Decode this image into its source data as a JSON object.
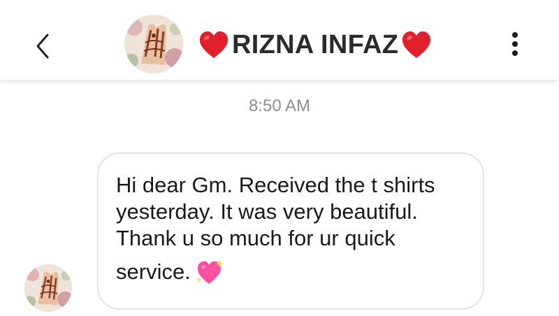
{
  "header": {
    "back_icon": "chevron-left-icon",
    "name": "RIZNA INFAZ",
    "heart_emoji": "❤️",
    "more_icon": "more-vertical-icon"
  },
  "conversation": {
    "timestamp": "8:50 AM",
    "messages": [
      {
        "lines": "Hi dear Gm. Received the t shirts\nyesterday. It was very beautiful.\nThank u so much for ur quick",
        "last_line": "service.",
        "emoji": "sparkling-heart-icon"
      }
    ]
  },
  "colors": {
    "heart_red": "#e0202a",
    "sparkle_pink": "#ff4fa3",
    "bubble_border": "#e3e3e3",
    "timestamp_gray": "#8e8e8e"
  }
}
